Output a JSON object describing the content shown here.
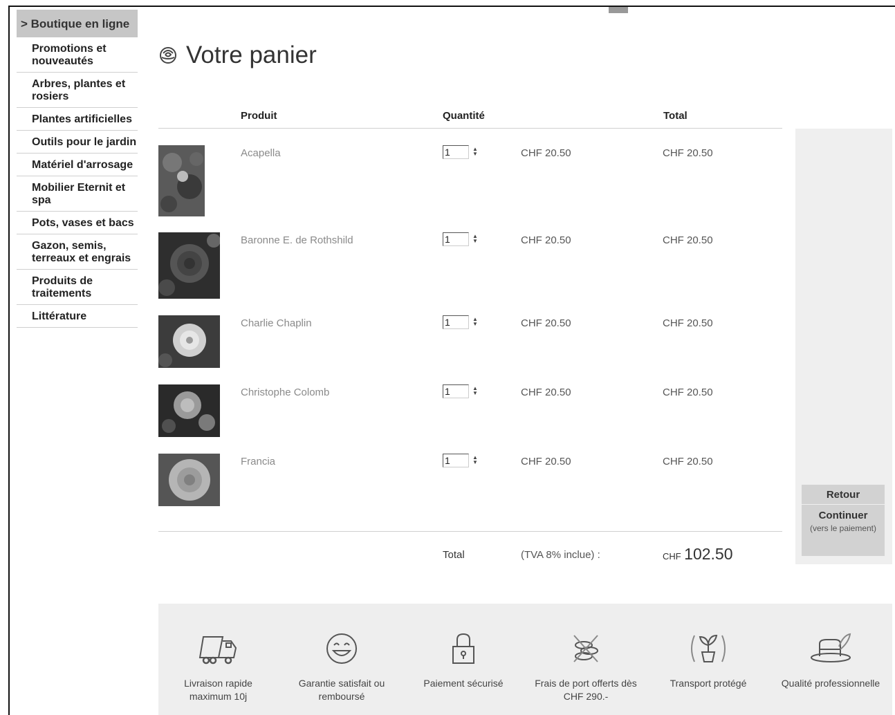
{
  "sidebar": {
    "header": "> Boutique en ligne",
    "items": [
      {
        "label": "Promotions et nouveautés"
      },
      {
        "label": "Arbres, plantes et rosiers"
      },
      {
        "label": "Plantes artificielles"
      },
      {
        "label": "Outils pour le jardin"
      },
      {
        "label": "Matériel d'arrosage"
      },
      {
        "label": "Mobilier Eternit et spa"
      },
      {
        "label": "Pots, vases et bacs"
      },
      {
        "label": "Gazon, semis, terreaux et engrais"
      },
      {
        "label": "Produits de traitements"
      },
      {
        "label": "Littérature"
      }
    ]
  },
  "cart": {
    "title": "Votre panier",
    "headers": {
      "product": "Produit",
      "quantity": "Quantité",
      "total": "Total"
    },
    "items": [
      {
        "name": "Acapella",
        "qty": "1",
        "price": "CHF 20.50",
        "total": "CHF 20.50"
      },
      {
        "name": "Baronne E. de Rothshild",
        "qty": "1",
        "price": "CHF 20.50",
        "total": "CHF 20.50"
      },
      {
        "name": "Charlie Chaplin",
        "qty": "1",
        "price": "CHF 20.50",
        "total": "CHF 20.50"
      },
      {
        "name": "Christophe Colomb",
        "qty": "1",
        "price": "CHF 20.50",
        "total": "CHF 20.50"
      },
      {
        "name": "Francia",
        "qty": "1",
        "price": "CHF 20.50",
        "total": "CHF 20.50"
      }
    ],
    "footer": {
      "total_label": "Total",
      "tva_label": "(TVA 8% inclue) :",
      "currency": "CHF",
      "amount": "102.50"
    }
  },
  "actions": {
    "back_label": "Retour",
    "continue_label": "Continuer",
    "continue_sub": "(vers le paiement)"
  },
  "features": [
    {
      "icon": "truck-icon",
      "label": "Livraison rapide maximum 10j"
    },
    {
      "icon": "smiley-icon",
      "label": "Garantie satisfait ou remboursé"
    },
    {
      "icon": "padlock-icon",
      "label": "Paiement sécurisé"
    },
    {
      "icon": "coins-crossed-icon",
      "label": "Frais de port offerts dès CHF 290.-"
    },
    {
      "icon": "plant-pot-icon",
      "label": "Transport protégé"
    },
    {
      "icon": "gardener-hat-icon",
      "label": "Qualité professionnelle"
    }
  ]
}
